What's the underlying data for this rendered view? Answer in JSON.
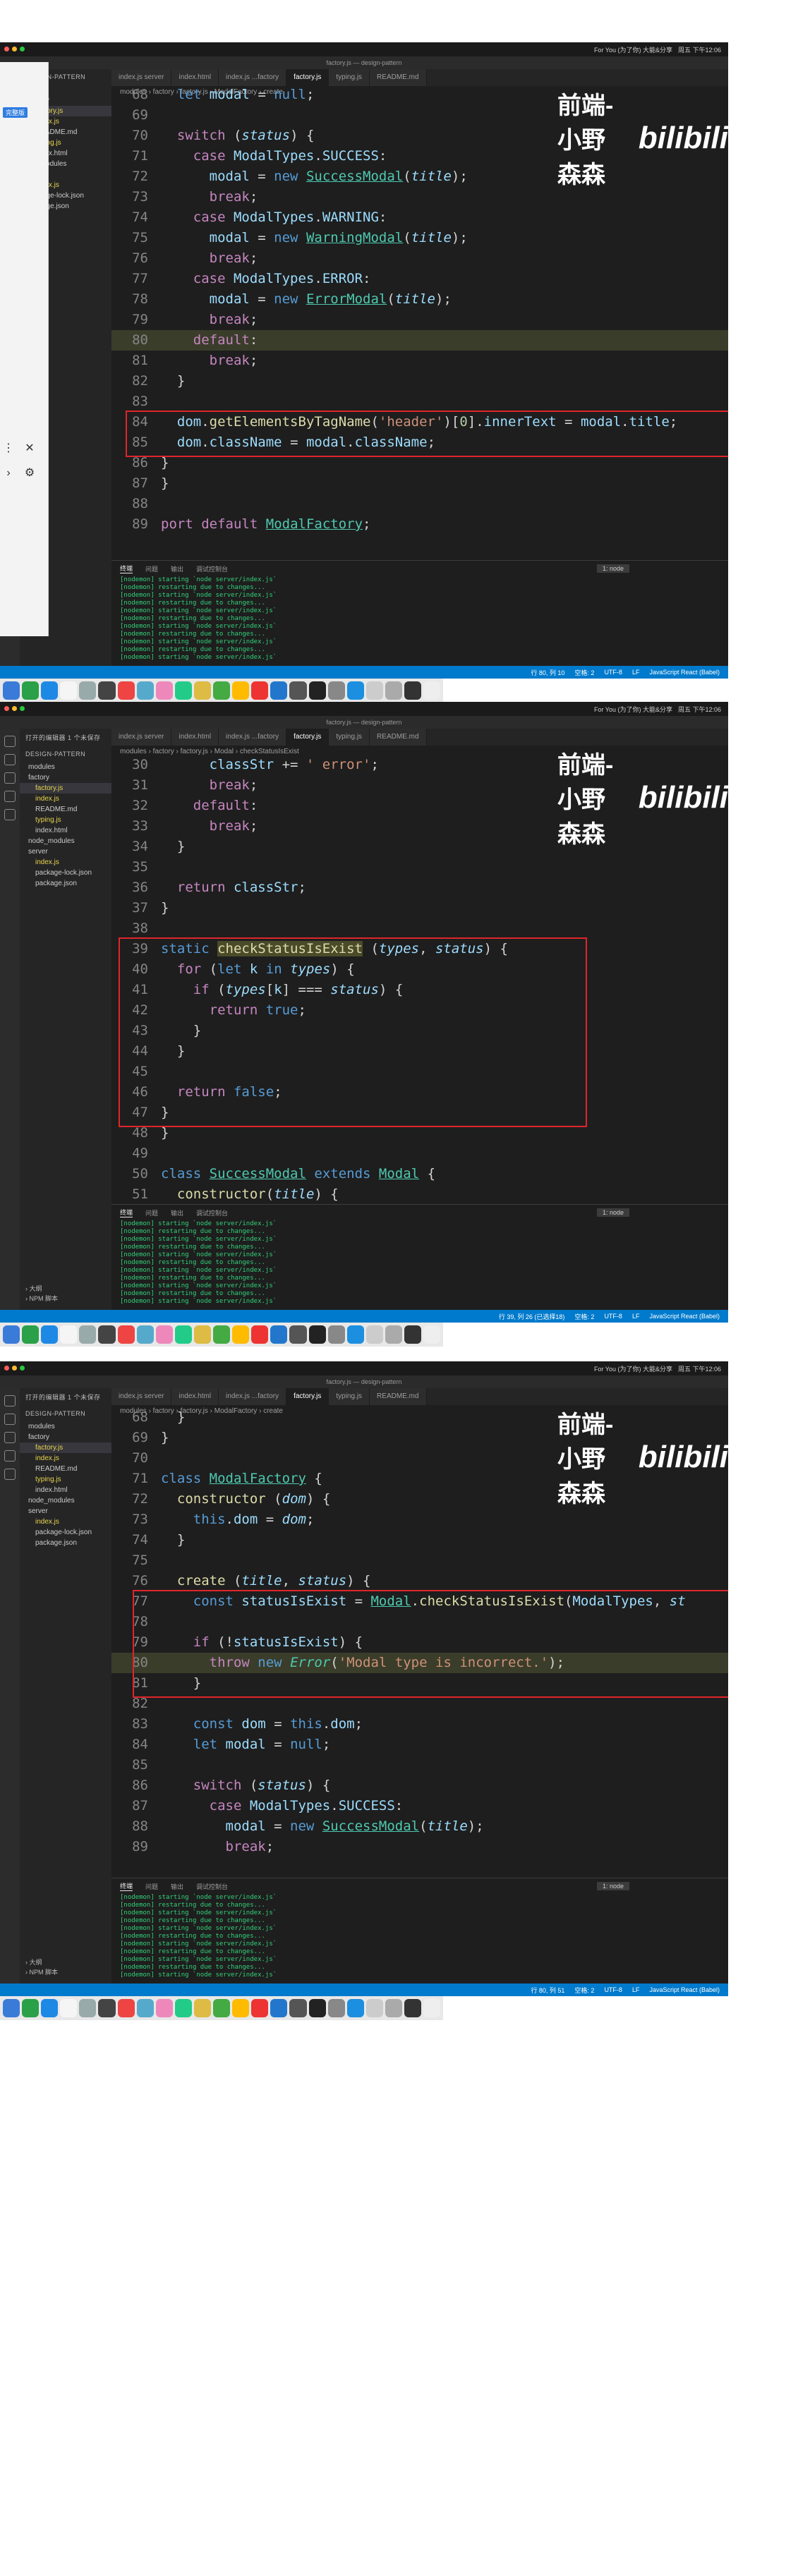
{
  "mac_bar": {
    "items": [
      "For You (为了你) 大能&分享",
      "周五 下午12:06"
    ]
  },
  "watermark": {
    "author": "前端-小野森森",
    "brand": "bilibili"
  },
  "panels": [
    {
      "window_title": "factory.js — design-pattern",
      "tabs": [
        "index.js server",
        "index.html",
        "index.js ...factory",
        "factory.js",
        "typing.js",
        "README.md"
      ],
      "active_tab": 3,
      "breadcrumb": "modules › factory › factory.js › ModalFactory › create",
      "sidebar_header": "DESIGN-PATTERN",
      "sidebar_items": [
        "odules",
        "factory",
        "factory.js",
        "index.js",
        "README.md",
        "typing.js",
        "index.html",
        "de_modules",
        "rver",
        "index.js",
        "ckage-lock.json",
        "ckage.json"
      ],
      "sidebar_active": 2,
      "overlay": {
        "button_label": "完整版",
        "close": "✕",
        "gear": "⚙",
        "more": "⋮",
        "chevron": "›"
      },
      "code_lines": [
        {
          "n": "68",
          "html": "  <span class='kw2'>let</span> <span class='var'>modal</span> = <span class='kw2'>null</span>;"
        },
        {
          "n": "69",
          "html": ""
        },
        {
          "n": "70",
          "html": "  <span class='kw'>switch</span> (<span class='prm'>status</span>) {"
        },
        {
          "n": "71",
          "html": "    <span class='kw'>case</span> <span class='var'>ModalTypes</span>.<span class='var'>SUCCESS</span>:"
        },
        {
          "n": "72",
          "html": "      <span class='var'>modal</span> = <span class='kw2'>new</span> <span class='cls'>SuccessModal</span>(<span class='prm'>title</span>);"
        },
        {
          "n": "73",
          "html": "      <span class='kw'>break</span>;"
        },
        {
          "n": "74",
          "html": "    <span class='kw'>case</span> <span class='var'>ModalTypes</span>.<span class='var'>WARNING</span>:"
        },
        {
          "n": "75",
          "html": "      <span class='var'>modal</span> = <span class='kw2'>new</span> <span class='cls'>WarningModal</span>(<span class='prm'>title</span>);"
        },
        {
          "n": "76",
          "html": "      <span class='kw'>break</span>;"
        },
        {
          "n": "77",
          "html": "    <span class='kw'>case</span> <span class='var'>ModalTypes</span>.<span class='var'>ERROR</span>:"
        },
        {
          "n": "78",
          "html": "      <span class='var'>modal</span> = <span class='kw2'>new</span> <span class='cls'>ErrorModal</span>(<span class='prm'>title</span>);"
        },
        {
          "n": "79",
          "html": "      <span class='kw'>break</span>;"
        },
        {
          "n": "80",
          "html": "    <span class='kw'>default</span>:",
          "hl": true
        },
        {
          "n": "81",
          "html": "      <span class='kw'>break</span>;"
        },
        {
          "n": "82",
          "html": "  }"
        },
        {
          "n": "83",
          "html": ""
        },
        {
          "n": "84",
          "html": "  <span class='var'>dom</span>.<span class='fn'>getElementsByTagName</span>(<span class='str'>'header'</span>)[<span class='num'>0</span>].<span class='var'>innerText</span> = <span class='var'>modal</span>.<span class='var'>title</span>;"
        },
        {
          "n": "85",
          "html": "  <span class='var'>dom</span>.<span class='var'>className</span> = <span class='var'>modal</span>.<span class='var'>className</span>;"
        },
        {
          "n": "86",
          "html": "}"
        },
        {
          "n": "87",
          "html": "}"
        },
        {
          "n": "88",
          "html": ""
        },
        {
          "n": "89",
          "html": "<span class='kw'>port</span> <span class='kw'>default</span> <span class='cls'>ModalFactory</span>;"
        }
      ],
      "term_tabs": [
        "终端",
        "问题",
        "输出",
        "调试控制台"
      ],
      "term_select": "1: node",
      "terminal": [
        "[nodemon] starting `node server/index.js`",
        "[nodemon] restarting due to changes...",
        "[nodemon] starting `node server/index.js`",
        "[nodemon] restarting due to changes...",
        "[nodemon] starting `node server/index.js`",
        "[nodemon] restarting due to changes...",
        "[nodemon] starting `node server/index.js`",
        "[nodemon] restarting due to changes...",
        "[nodemon] starting `node server/index.js`",
        "[nodemon] restarting due to changes...",
        "[nodemon] starting `node server/index.js`"
      ],
      "status": [
        "行 80, 列 10",
        "空格: 2",
        "UTF-8",
        "LF",
        "JavaScript React (Babel)"
      ]
    },
    {
      "window_title": "factory.js — design-pattern",
      "tabs": [
        "index.js server",
        "index.html",
        "index.js ...factory",
        "factory.js",
        "typing.js",
        "README.md"
      ],
      "active_tab": 3,
      "breadcrumb": "modules › factory › factory.js › Modal › checkStatusIsExist",
      "sidebar_header": "DESIGN-PATTERN",
      "sidebar_top": "打开的编辑器 1 个未保存",
      "sidebar_items": [
        "modules",
        "factory",
        "factory.js",
        "index.js",
        "README.md",
        "typing.js",
        "index.html",
        "node_modules",
        "server",
        "index.js",
        "package-lock.json",
        "package.json"
      ],
      "sidebar_active": 2,
      "sidebar_bottom": [
        "› 大纲",
        "› NPM 脚本"
      ],
      "code_lines": [
        {
          "n": "30",
          "html": "      <span class='var'>classStr</span> += <span class='str'>' error'</span>;"
        },
        {
          "n": "31",
          "html": "      <span class='kw'>break</span>;"
        },
        {
          "n": "32",
          "html": "    <span class='kw'>default</span>:"
        },
        {
          "n": "33",
          "html": "      <span class='kw'>break</span>;"
        },
        {
          "n": "34",
          "html": "  }"
        },
        {
          "n": "35",
          "html": ""
        },
        {
          "n": "36",
          "html": "  <span class='kw'>return</span> <span class='var'>classStr</span>;"
        },
        {
          "n": "37",
          "html": "}"
        },
        {
          "n": "38",
          "html": ""
        },
        {
          "n": "39",
          "html": "<span class='kw2'>static</span> <span class='fn' style='background:#4b4b2a'>checkStatusIsExist</span> (<span class='prm'>types</span>, <span class='prm'>status</span>) {"
        },
        {
          "n": "40",
          "html": "  <span class='kw'>for</span> (<span class='kw2'>let</span> <span class='var'>k</span> <span class='kw2'>in</span> <span class='prm'>types</span>) {"
        },
        {
          "n": "41",
          "html": "    <span class='kw'>if</span> (<span class='prm'>types</span>[<span class='var'>k</span>] === <span class='prm'>status</span>) {"
        },
        {
          "n": "42",
          "html": "      <span class='kw'>return</span> <span class='kw2'>true</span>;"
        },
        {
          "n": "43",
          "html": "    }"
        },
        {
          "n": "44",
          "html": "  }"
        },
        {
          "n": "45",
          "html": ""
        },
        {
          "n": "46",
          "html": "  <span class='kw'>return</span> <span class='kw2'>false</span>;"
        },
        {
          "n": "47",
          "html": "}"
        },
        {
          "n": "48",
          "html": "}"
        },
        {
          "n": "49",
          "html": ""
        },
        {
          "n": "50",
          "html": "<span class='kw2'>class</span> <span class='cls'>SuccessModal</span> <span class='kw2'>extends</span> <span class='cls'>Modal</span> {"
        },
        {
          "n": "51",
          "html": "  <span class='fn'>constructor</span>(<span class='prm'>title</span>) {"
        }
      ],
      "term_tabs": [
        "终端",
        "问题",
        "输出",
        "调试控制台"
      ],
      "term_select": "1: node",
      "terminal": [
        "[nodemon] starting `node server/index.js`",
        "[nodemon] restarting due to changes...",
        "[nodemon] starting `node server/index.js`",
        "[nodemon] restarting due to changes...",
        "[nodemon] starting `node server/index.js`",
        "[nodemon] restarting due to changes...",
        "[nodemon] starting `node server/index.js`",
        "[nodemon] restarting due to changes...",
        "[nodemon] starting `node server/index.js`",
        "[nodemon] restarting due to changes...",
        "[nodemon] starting `node server/index.js`"
      ],
      "status": [
        "行 39, 列 26 (已选择18)",
        "空格: 2",
        "UTF-8",
        "LF",
        "JavaScript React (Babel)"
      ]
    },
    {
      "window_title": "factory.js — design-pattern",
      "tabs": [
        "index.js server",
        "index.html",
        "index.js ...factory",
        "factory.js",
        "typing.js",
        "README.md"
      ],
      "active_tab": 3,
      "breadcrumb": "modules › factory › factory.js › ModalFactory › create",
      "sidebar_header": "DESIGN-PATTERN",
      "sidebar_top": "打开的编辑器 1 个未保存",
      "sidebar_items": [
        "modules",
        "factory",
        "factory.js",
        "index.js",
        "README.md",
        "typing.js",
        "index.html",
        "node_modules",
        "server",
        "index.js",
        "package-lock.json",
        "package.json"
      ],
      "sidebar_active": 2,
      "sidebar_bottom": [
        "› 大纲",
        "› NPM 脚本"
      ],
      "code_lines": [
        {
          "n": "68",
          "html": "  }"
        },
        {
          "n": "69",
          "html": "}"
        },
        {
          "n": "70",
          "html": ""
        },
        {
          "n": "71",
          "html": "<span class='kw2'>class</span> <span class='cls'>ModalFactory</span> {"
        },
        {
          "n": "72",
          "html": "  <span class='fn'>constructor</span> (<span class='prm'>dom</span>) {"
        },
        {
          "n": "73",
          "html": "    <span class='kw2'>this</span>.<span class='var'>dom</span> = <span class='prm'>dom</span>;"
        },
        {
          "n": "74",
          "html": "  }"
        },
        {
          "n": "75",
          "html": ""
        },
        {
          "n": "76",
          "html": "  <span class='fn'>create</span> (<span class='prm'>title</span>, <span class='prm'>status</span>) {"
        },
        {
          "n": "77",
          "html": "    <span class='kw2'>const</span> <span class='var'>statusIsExist</span> = <span class='cls'>Modal</span>.<span class='fn'>checkStatusIsExist</span>(<span class='var'>ModalTypes</span>, <span class='prm'>st</span>"
        },
        {
          "n": "78",
          "html": ""
        },
        {
          "n": "79",
          "html": "    <span class='kw'>if</span> (!<span class='var'>statusIsExist</span>) {"
        },
        {
          "n": "80",
          "html": "      <span class='kw'>throw</span> <span class='kw2'>new</span> <span class='cls' style='text-decoration:none;font-style:italic'>Error</span>(<span class='str'>'Modal type is incorrect.'</span>);",
          "hl": true
        },
        {
          "n": "81",
          "html": "    }"
        },
        {
          "n": "82",
          "html": ""
        },
        {
          "n": "83",
          "html": "    <span class='kw2'>const</span> <span class='var'>dom</span> = <span class='kw2'>this</span>.<span class='var'>dom</span>;"
        },
        {
          "n": "84",
          "html": "    <span class='kw2'>let</span> <span class='var'>modal</span> = <span class='kw2'>null</span>;"
        },
        {
          "n": "85",
          "html": ""
        },
        {
          "n": "86",
          "html": "    <span class='kw'>switch</span> (<span class='prm'>status</span>) {"
        },
        {
          "n": "87",
          "html": "      <span class='kw'>case</span> <span class='var'>ModalTypes</span>.<span class='var'>SUCCESS</span>:"
        },
        {
          "n": "88",
          "html": "        <span class='var'>modal</span> = <span class='kw2'>new</span> <span class='cls'>SuccessModal</span>(<span class='prm'>title</span>);"
        },
        {
          "n": "89",
          "html": "        <span class='kw'>break</span>;"
        }
      ],
      "term_tabs": [
        "终端",
        "问题",
        "输出",
        "调试控制台"
      ],
      "term_select": "1: node",
      "terminal": [
        "[nodemon] starting `node server/index.js`",
        "[nodemon] restarting due to changes...",
        "[nodemon] starting `node server/index.js`",
        "[nodemon] restarting due to changes...",
        "[nodemon] starting `node server/index.js`",
        "[nodemon] restarting due to changes...",
        "[nodemon] starting `node server/index.js`",
        "[nodemon] restarting due to changes...",
        "[nodemon] starting `node server/index.js`",
        "[nodemon] restarting due to changes...",
        "[nodemon] starting `node server/index.js`"
      ],
      "status": [
        "行 80, 列 51",
        "空格: 2",
        "UTF-8",
        "LF",
        "JavaScript React (Babel)"
      ]
    }
  ],
  "colors": {
    "editor_bg": "#1e1e1e",
    "statusbar": "#007acc",
    "highlight_box": "#e0252b",
    "terminal_text": "#33d17a"
  }
}
